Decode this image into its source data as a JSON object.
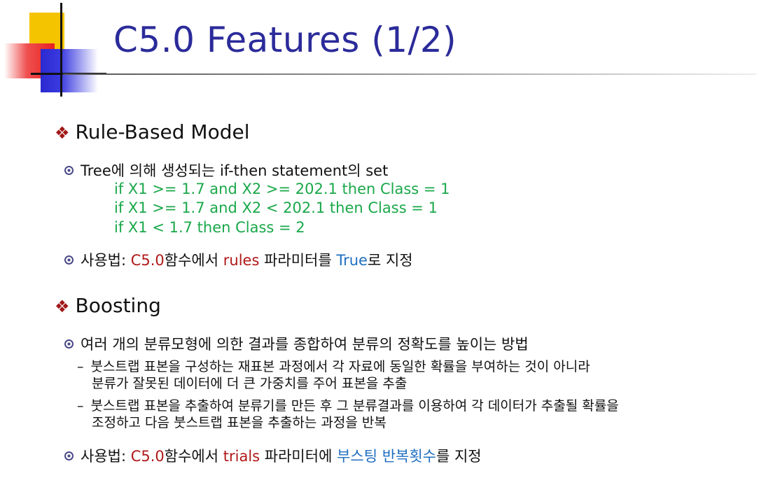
{
  "slide": {
    "title": "C5.0 Features (1/2)"
  },
  "rule_section": {
    "heading": "Rule-Based Model",
    "point1": "Tree에 의해 생성되는 if-then statement의 set",
    "rules": [
      "if X1 >= 1.7 and X2 >= 202.1 then Class = 1",
      "if X1 >= 1.7 and X2 < 202.1 then Class = 1",
      "if X1 < 1.7 then Class = 2"
    ],
    "usage": {
      "prefix": "사용법: ",
      "func": "C5.0",
      "mid1": "함수에서 ",
      "param": "rules",
      "mid2": " 파라미터를 ",
      "value": "True",
      "suffix": "로 지정"
    }
  },
  "boost_section": {
    "heading": "Boosting",
    "point1": "여러 개의 분류모형에 의한 결과를 종합하여 분류의 정확도를 높이는 방법",
    "sub1": {
      "line1": "붓스트랩 표본을 구성하는 재표본 과정에서 각 자료에 동일한 확률을 부여하는 것이 아니라",
      "line2": "분류가 잘못된 데이터에 더 큰 가중치를 주어 표본을 추출"
    },
    "sub2": {
      "line1": "붓스트랩 표본을 추출하여 분류기를 만든 후 그 분류결과를 이용하여 각 데이터가 추출될 확률을",
      "line2": "조정하고 다음 붓스트랩 표본을 추출하는 과정을 반복"
    },
    "usage": {
      "prefix": "사용법: ",
      "func": "C5.0",
      "mid1": "함수에서 ",
      "param": "trials",
      "mid2": " 파라미터에 ",
      "value": "부스팅 반복횟수",
      "suffix": "를 지정"
    }
  },
  "glyphs": {
    "diamond": "❖",
    "dash": "–"
  },
  "colors": {
    "title": "#2b2b9a",
    "code": "#1aa84a",
    "keyword_red": "#b01818",
    "keyword_blue": "#1f6fc0"
  }
}
